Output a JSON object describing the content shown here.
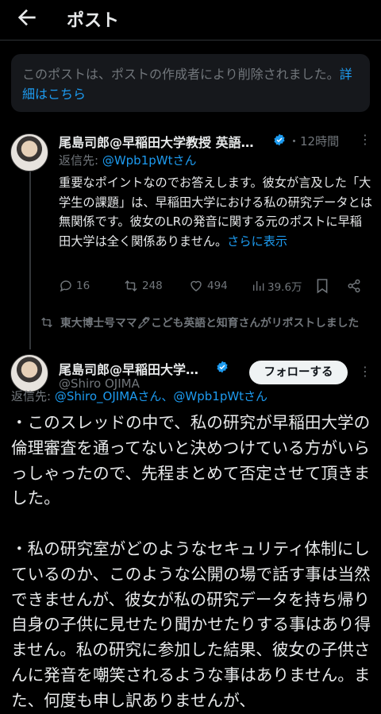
{
  "header": {
    "title": "ポスト",
    "back_icon": "arrow-left-icon"
  },
  "deleted_notice": {
    "text": "このポストは、ポストの作成者により削除されました。",
    "link": "詳細はこちら"
  },
  "tweet1": {
    "author": "尾島司郎@早稲田大学教授 英語…",
    "time": "・12時間",
    "reply_label": "返信先: ",
    "reply_handle": "@Wpb1pWtさん",
    "text": "重要なポイントなのでお答えします。彼女が言及した「大学生の課題」は、早稲田大学における私の研究データとは無関係です。彼女のLRの発音に関する元のポストに早稲田大学は全く関係ありません。",
    "show_more": "さらに表示",
    "stats": {
      "replies": "16",
      "reposts": "248",
      "likes": "494",
      "views": "39.6万"
    }
  },
  "repost_notice": "東大博士号ママ🖊こども英語と知育さんがリポストしました",
  "tweet2": {
    "author": "尾島司郎@早稲田大学…",
    "follow_label": "フォローする",
    "reply_label": "返信先: ",
    "reply_handles": "@Shiro_OJIMAさん、@Wpb1pWtさん",
    "handle_overlay": "@Shiro OJIMA",
    "text_p1": "・このスレッドの中で、私の研究が早稲田大学の倫理審査を通ってないと決めつけている方がいらっしゃったので、先程まとめて否定させて頂きました。",
    "text_p2": "・私の研究室がどのようなセキュリティ体制にしているのか、このような公開の場で話す事は当然できませんが、彼女が私の研究データを持ち帰り自身の子供に見せたり聞かせたりする事はあり得ません。私の研究に参加した結果、彼女の子供さんに発音を嘲笑されるような事はありません。また、何度も申し訳ありませんが、"
  },
  "colors": {
    "accent": "#1d9bf0",
    "muted": "#71767b",
    "text": "#e7e9ea",
    "background": "#000000"
  }
}
